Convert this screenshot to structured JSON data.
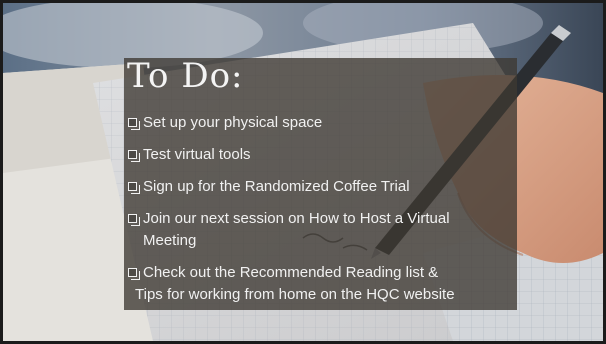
{
  "slide": {
    "title": "To Do:",
    "items": [
      {
        "text": "Set up your physical space"
      },
      {
        "text": "Test virtual tools"
      },
      {
        "text": "Sign up for the Randomized  Coffee  Trial"
      },
      {
        "text": "Join our next session on How to Host a Virtual",
        "text2": "Meeting"
      },
      {
        "text": "Check out the Recommended  Reading list &",
        "text2": "Tips for working  from home on the HQC website"
      }
    ]
  },
  "colors": {
    "panel": "#3e3832",
    "text": "#f1f1f1",
    "frame": "#1b1b1b"
  },
  "icons": {
    "checkbox": "checkbox-icon",
    "background": "notebook-checklist-photo"
  }
}
